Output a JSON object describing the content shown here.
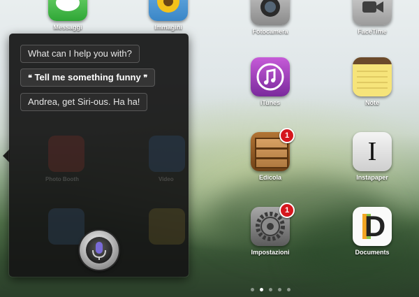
{
  "siri": {
    "prompt": "What can I help you with?",
    "user_query": "Tell me something funny",
    "open_quote": "❝",
    "close_quote": "❞",
    "response": "Andrea, get Siri-ous. Ha ha!"
  },
  "apps": {
    "messaggi": "Messaggi",
    "immagini": "Immagini",
    "fotocamera": "Fotocamera",
    "facetime": "FaceTime",
    "itunes": "iTunes",
    "note": "Note",
    "edicola": "Edicola",
    "edicola_badge": "1",
    "instapaper": "Instapaper",
    "instapaper_glyph": "I",
    "impostazioni": "Impostazioni",
    "impostazioni_badge": "1",
    "documents": "Documents",
    "documents_glyph": "D"
  },
  "ghost_apps": {
    "row1_left": "Photo Booth",
    "row1_right": "Video"
  },
  "page_indicator": {
    "total": 5,
    "active": 1
  },
  "colors": {
    "siri_panel": "#161616",
    "badge": "#d5161d",
    "mic_purple": "#7a6bd8"
  }
}
